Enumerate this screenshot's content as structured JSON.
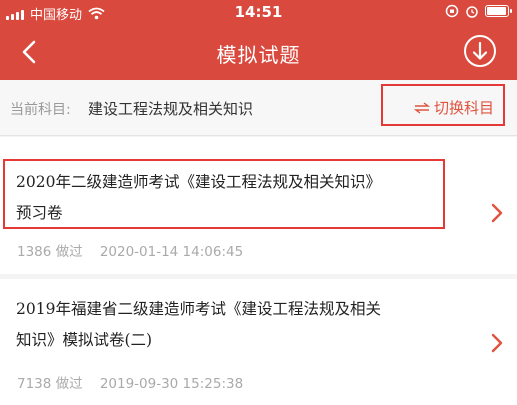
{
  "status_bar": {
    "carrier": "中国移动",
    "time": "14:51"
  },
  "nav": {
    "title": "模拟试题",
    "back_icon": "back-arrow-icon",
    "download_icon": "download-circle-icon"
  },
  "subject": {
    "label": "当前科目:",
    "value": "建设工程法规及相关知识",
    "switch_label": "切换科目",
    "switch_icon": "swap-icon"
  },
  "colors": {
    "accent": "#d9493d",
    "highlight": "#e53935",
    "meta": "#aaaaaa"
  },
  "exams": [
    {
      "title_line1": "2020年二级建造师考试《建设工程法规及相关知识》",
      "title_line2": "预习卷",
      "meta": "1386 做过    2020-01-14 14:06:45"
    },
    {
      "title_line1": "2019年福建省二级建造师考试《建设工程法规及相关",
      "title_line2": "知识》模拟试卷(二)",
      "meta": "7138 做过    2019-09-30 15:25:38"
    }
  ]
}
